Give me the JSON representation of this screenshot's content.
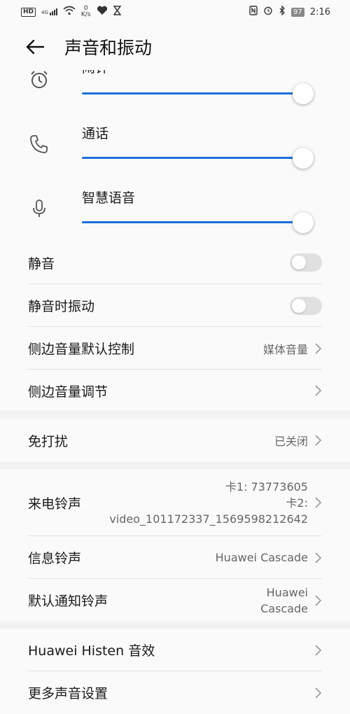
{
  "status_bar": {
    "hd": "HD",
    "signal": "4G",
    "speed_value": "0",
    "speed_unit": "K/s",
    "battery": "97",
    "time": "2:16"
  },
  "header": {
    "title": "声音和振动"
  },
  "volume_sliders": [
    {
      "label": "闹钟",
      "icon": "alarm-clock-icon",
      "level": 1.0
    },
    {
      "label": "通话",
      "icon": "phone-icon",
      "level": 1.0
    },
    {
      "label": "智慧语音",
      "icon": "microphone-icon",
      "level": 1.0
    }
  ],
  "toggles": [
    {
      "label": "静音",
      "on": false
    },
    {
      "label": "静音时振动",
      "on": false
    }
  ],
  "side_volume": {
    "default_label": "侧边音量默认控制",
    "default_value": "媒体音量",
    "adjust_label": "侧边音量调节"
  },
  "dnd": {
    "label": "免打扰",
    "value": "已关闭"
  },
  "ringtones": {
    "incoming_label": "来电铃声",
    "incoming_card1": "卡1: 73773605",
    "incoming_card2": "卡2:",
    "incoming_card2_value": "video_101172337_1569598212642",
    "message_label": "信息铃声",
    "message_value": "Huawei Cascade",
    "notification_label": "默认通知铃声",
    "notification_value_line1": "Huawei",
    "notification_value_line2": "Cascade"
  },
  "more": {
    "histen_label": "Huawei Histen 音效",
    "more_label": "更多声音设置"
  },
  "colors": {
    "accent": "#1e6fd9",
    "background": "#f2f2f2",
    "card": "#fafafa"
  }
}
